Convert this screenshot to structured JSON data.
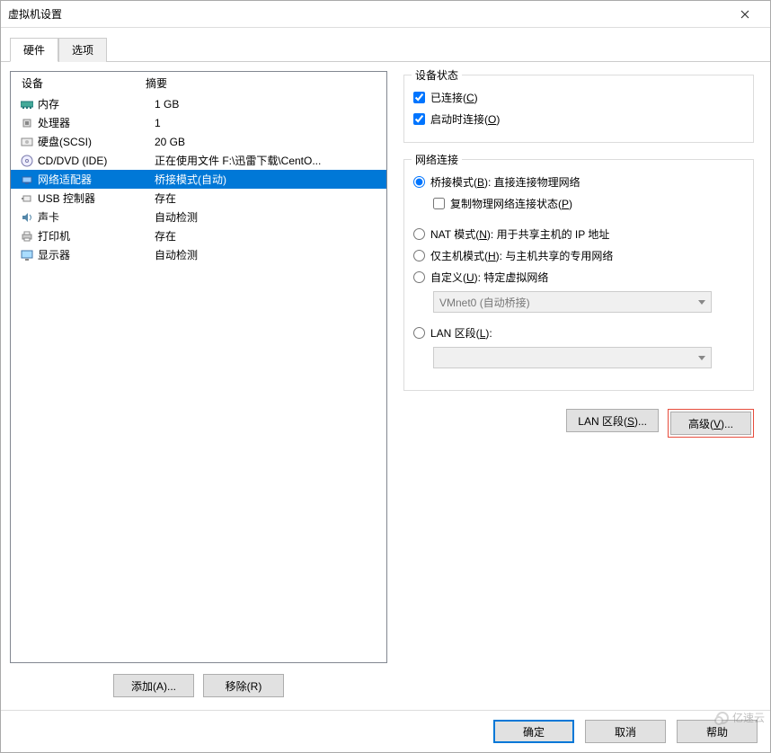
{
  "window": {
    "title": "虚拟机设置"
  },
  "tabs": {
    "hardware": "硬件",
    "options": "选项"
  },
  "list": {
    "head_device": "设备",
    "head_summary": "摘要",
    "rows": [
      {
        "name": "内存",
        "summary": "1 GB"
      },
      {
        "name": "处理器",
        "summary": "1"
      },
      {
        "name": "硬盘(SCSI)",
        "summary": "20 GB"
      },
      {
        "name": "CD/DVD (IDE)",
        "summary": "正在使用文件 F:\\迅雷下载\\CentO..."
      },
      {
        "name": "网络适配器",
        "summary": "桥接模式(自动)"
      },
      {
        "name": "USB 控制器",
        "summary": "存在"
      },
      {
        "name": "声卡",
        "summary": "自动检测"
      },
      {
        "name": "打印机",
        "summary": "存在"
      },
      {
        "name": "显示器",
        "summary": "自动检测"
      }
    ],
    "add": "添加(A)...",
    "remove": "移除(R)"
  },
  "status_group": {
    "title": "设备状态",
    "connected": "已连接(C)",
    "connect_at_power": "启动时连接(O)"
  },
  "net_group": {
    "title": "网络连接",
    "bridged": "桥接模式(B): 直接连接物理网络",
    "replicate": "复制物理网络连接状态(P)",
    "nat": "NAT 模式(N): 用于共享主机的 IP 地址",
    "hostonly": "仅主机模式(H): 与主机共享的专用网络",
    "custom": "自定义(U): 特定虚拟网络",
    "custom_dd": "VMnet0 (自动桥接)",
    "lan": "LAN 区段(L):",
    "lan_btn": "LAN 区段(S)...",
    "adv_btn": "高级(V)..."
  },
  "footer": {
    "ok": "确定",
    "cancel": "取消",
    "help": "帮助"
  },
  "watermark": "亿速云"
}
